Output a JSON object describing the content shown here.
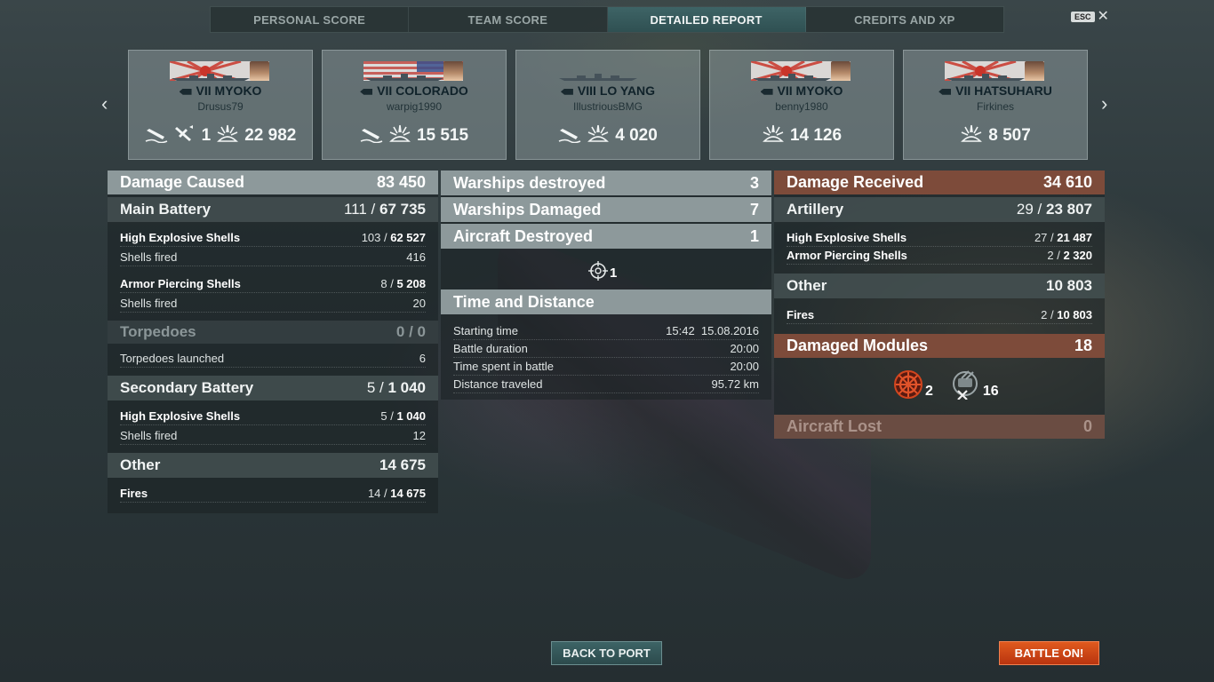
{
  "tabs": [
    "PERSONAL SCORE",
    "TEAM SCORE",
    "DETAILED REPORT",
    "CREDITS AND XP"
  ],
  "esc": {
    "key": "ESC"
  },
  "cards": [
    {
      "ship": "VII MYOKO",
      "player": "Drusus79",
      "nation": "japan",
      "icons": [
        "ship-sunk-icon",
        "plane-down-icon",
        "damage-icon"
      ],
      "plane_count": "1",
      "damage": "22 982"
    },
    {
      "ship": "VII COLORADO",
      "player": "warpig1990",
      "nation": "usa",
      "icons": [
        "ship-sunk-icon",
        "damage-icon"
      ],
      "damage": "15 515"
    },
    {
      "ship": "VIII LO YANG",
      "player": "IllustriousBMG",
      "nation": "none",
      "icons": [
        "ship-sunk-icon",
        "damage-icon"
      ],
      "damage": "4 020"
    },
    {
      "ship": "VII MYOKO",
      "player": "benny1980",
      "nation": "japan",
      "icons": [
        "damage-icon"
      ],
      "damage": "14 126"
    },
    {
      "ship": "VII HATSUHARU",
      "player": "Firkines",
      "nation": "japan",
      "icons": [
        "damage-icon"
      ],
      "damage": "8 507"
    }
  ],
  "left": {
    "damage_caused": {
      "label": "Damage Caused",
      "value": "83 450"
    },
    "main_battery": {
      "label": "Main Battery",
      "hits": "111 / ",
      "dmg": "67 735"
    },
    "he": {
      "label": "High Explosive Shells",
      "hits": "103 / ",
      "dmg": "62 527"
    },
    "he_fired": {
      "label": "Shells fired",
      "value": "416"
    },
    "ap": {
      "label": "Armor Piercing Shells",
      "hits": "8 / ",
      "dmg": "5 208"
    },
    "ap_fired": {
      "label": "Shells fired",
      "value": "20"
    },
    "torpedoes": {
      "label": "Torpedoes",
      "value": "0 / 0"
    },
    "torp_launched": {
      "label": "Torpedoes launched",
      "value": "6"
    },
    "secondary": {
      "label": "Secondary Battery",
      "hits": "5 / ",
      "dmg": "1 040"
    },
    "sec_he": {
      "label": "High Explosive Shells",
      "hits": "5 / ",
      "dmg": "1 040"
    },
    "sec_fired": {
      "label": "Shells fired",
      "value": "12"
    },
    "other": {
      "label": "Other",
      "value": "14 675"
    },
    "fires": {
      "label": "Fires",
      "hits": "14 / ",
      "dmg": "14 675"
    }
  },
  "middle": {
    "destroyed": {
      "label": "Warships destroyed",
      "value": "3"
    },
    "damaged": {
      "label": "Warships Damaged",
      "value": "7"
    },
    "aircraft": {
      "label": "Aircraft Destroyed",
      "value": "1"
    },
    "aircraft_icon_count": "1",
    "time_distance": {
      "label": "Time and Distance"
    },
    "start": {
      "label": "Starting time",
      "value": "15:42  15.08.2016"
    },
    "duration": {
      "label": "Battle duration",
      "value": "20:00"
    },
    "spent": {
      "label": "Time spent in battle",
      "value": "20:00"
    },
    "distance": {
      "label": "Distance traveled",
      "value": "95.72 km"
    }
  },
  "right": {
    "received": {
      "label": "Damage Received",
      "value": "34 610"
    },
    "artillery": {
      "label": "Artillery",
      "hits": "29 / ",
      "dmg": "23 807"
    },
    "he": {
      "label": "High Explosive Shells",
      "hits": "27 / ",
      "dmg": "21 487"
    },
    "ap": {
      "label": "Armor Piercing Shells",
      "hits": "2 / ",
      "dmg": "2 320"
    },
    "other": {
      "label": "Other",
      "value": "10 803"
    },
    "fires": {
      "label": "Fires",
      "hits": "2 / ",
      "dmg": "10 803"
    },
    "modules": {
      "label": "Damaged Modules",
      "value": "18"
    },
    "steering_count": "2",
    "gun_count": "16",
    "aircraft_lost": {
      "label": "Aircraft Lost",
      "value": "0"
    }
  },
  "buttons": {
    "back": "BACK TO PORT",
    "battle": "BATTLE ON!"
  },
  "colors": {
    "accent": "#3e6466",
    "battle": "#d0451a",
    "received": "#7d4b3a"
  }
}
